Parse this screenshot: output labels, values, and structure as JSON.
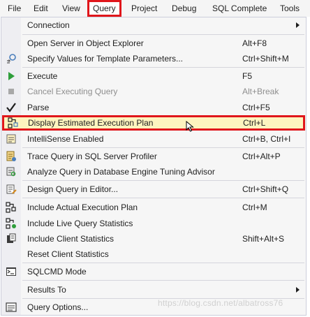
{
  "menubar": {
    "items": [
      "File",
      "Edit",
      "View",
      "Query",
      "Project",
      "Debug",
      "SQL Complete",
      "Tools"
    ]
  },
  "menu": {
    "items": [
      {
        "label": "Connection",
        "shortcut": "",
        "submenu": true,
        "icon": "none"
      },
      {
        "label": "Open Server in Object Explorer",
        "shortcut": "Alt+F8",
        "icon": "none"
      },
      {
        "label": "Specify Values for Template Parameters...",
        "shortcut": "Ctrl+Shift+M",
        "icon": "template-params-icon"
      },
      {
        "label": "Execute",
        "shortcut": "F5",
        "icon": "execute-icon"
      },
      {
        "label": "Cancel Executing Query",
        "shortcut": "Alt+Break",
        "icon": "cancel-query-icon",
        "disabled": true
      },
      {
        "label": "Parse",
        "shortcut": "Ctrl+F5",
        "icon": "parse-checkmark-icon"
      },
      {
        "label": "Display Estimated Execution Plan",
        "shortcut": "Ctrl+L",
        "icon": "estimated-plan-icon",
        "highlighted": true
      },
      {
        "label": "IntelliSense Enabled",
        "shortcut": "Ctrl+B, Ctrl+I",
        "icon": "intellisense-icon"
      },
      {
        "label": "Trace Query in SQL Server Profiler",
        "shortcut": "Ctrl+Alt+P",
        "icon": "profiler-icon"
      },
      {
        "label": "Analyze Query in Database Engine Tuning Advisor",
        "shortcut": "",
        "icon": "tuning-advisor-icon"
      },
      {
        "label": "Design Query in Editor...",
        "shortcut": "Ctrl+Shift+Q",
        "icon": "design-query-icon"
      },
      {
        "label": "Include Actual Execution Plan",
        "shortcut": "Ctrl+M",
        "icon": "actual-plan-icon"
      },
      {
        "label": "Include Live Query Statistics",
        "shortcut": "",
        "icon": "live-stats-icon"
      },
      {
        "label": "Include Client Statistics",
        "shortcut": "Shift+Alt+S",
        "icon": "client-stats-icon"
      },
      {
        "label": "Reset Client Statistics",
        "shortcut": "",
        "icon": "none"
      },
      {
        "label": "SQLCMD Mode",
        "shortcut": "",
        "icon": "sqlcmd-icon"
      },
      {
        "label": "Results To",
        "shortcut": "",
        "submenu": true,
        "icon": "none"
      },
      {
        "label": "Query Options...",
        "shortcut": "",
        "icon": "query-options-icon"
      }
    ]
  },
  "watermark": "https://blog.csdn.net/albatross76",
  "colors": {
    "highlight_border": "#e0161b",
    "highlight_fill": "#fdf4bf",
    "execute_green": "#2e9e3b"
  }
}
